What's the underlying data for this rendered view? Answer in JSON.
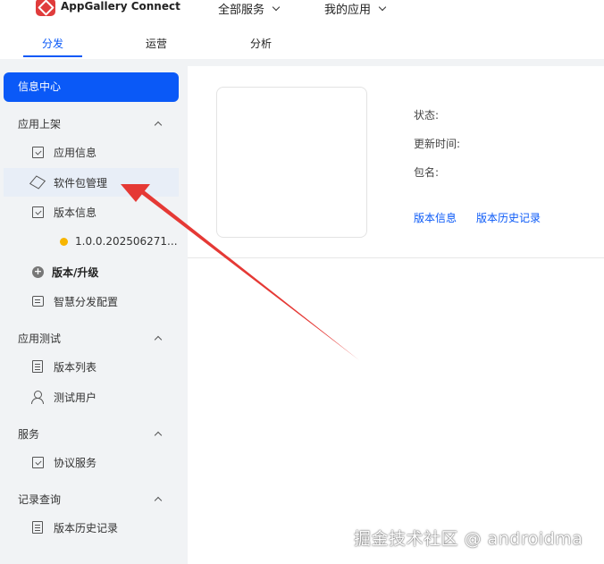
{
  "app": {
    "brand": "AppGallery Connect",
    "brand_color": "#e03c3c",
    "accent": "#0a59f7"
  },
  "topnav": {
    "all_services": "全部服务",
    "my_apps": "我的应用"
  },
  "tabs": [
    {
      "label": "分发"
    },
    {
      "label": "运营"
    },
    {
      "label": "分析"
    }
  ],
  "sidebar": {
    "info_center": "信息中心",
    "groups": {
      "release": "应用上架",
      "testing": "应用测试",
      "services": "服务",
      "records": "记录查询"
    },
    "items": {
      "app_info": "应用信息",
      "package_mgmt": "软件包管理",
      "version_info": "版本信息",
      "version_number": "1.0.0.202506271...",
      "version_upgrade": "版本/升级",
      "smart_distribution": "智慧分发配置",
      "version_list": "版本列表",
      "test_users": "测试用户",
      "agreement": "协议服务",
      "version_history": "版本历史记录"
    }
  },
  "main": {
    "status_label": "状态:",
    "update_time_label": "更新时间:",
    "package_name_label": "包名:",
    "links": {
      "version_info": "版本信息",
      "version_history": "版本历史记录"
    }
  },
  "annotation": {
    "arrow_color": "#e53935"
  },
  "watermark": "掘金技术社区 @ androidma"
}
